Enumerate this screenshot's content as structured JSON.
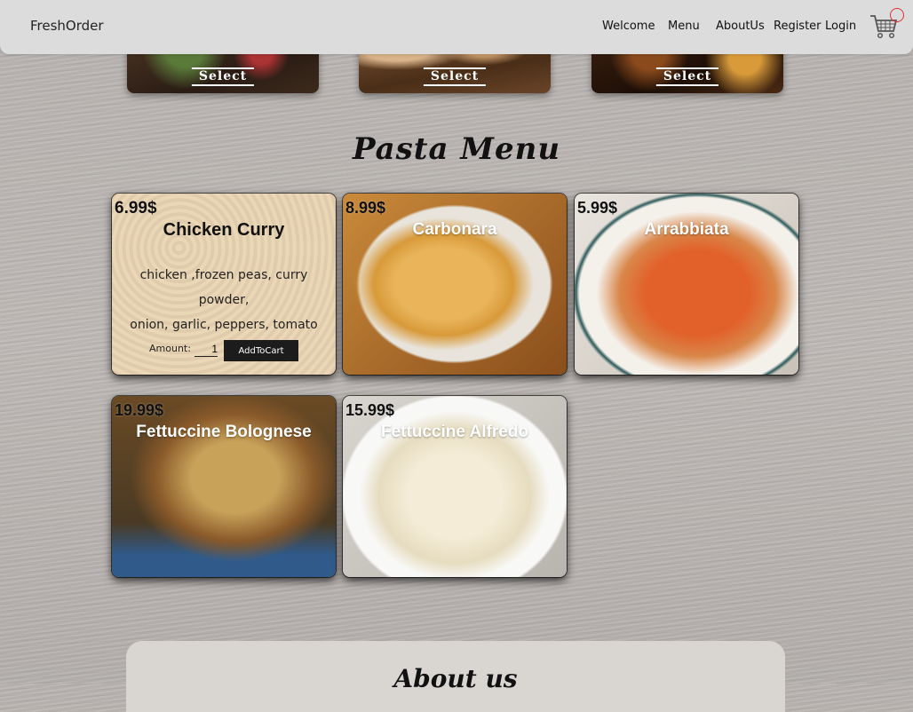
{
  "nav": {
    "brand": "FreshOrder",
    "links": [
      "Welcome",
      "Menu",
      "AboutUs",
      "Register",
      "Login"
    ]
  },
  "categories": [
    {
      "label": "Select"
    },
    {
      "label": "Select"
    },
    {
      "label": "Select"
    }
  ],
  "menu": {
    "title": "Pasta Menu",
    "items": [
      {
        "price": "6.99$",
        "name": "Chicken Curry",
        "description_line1": "chicken ,frozen peas, curry powder,",
        "description_line2": "onion, garlic, peppers, tomato",
        "amount_label": "Amount:",
        "amount_value": "1",
        "add_label": "AddToCart"
      },
      {
        "price": "8.99$",
        "name": "Carbonara"
      },
      {
        "price": "5.99$",
        "name": "Arrabbiata"
      },
      {
        "price": "19.99$",
        "name": "Fettuccine Bolognese"
      },
      {
        "price": "15.99$",
        "name": "Fettuccine Alfredo"
      }
    ]
  },
  "about": {
    "title": "About us"
  },
  "icons": {
    "cart": "shopping-cart-icon"
  }
}
